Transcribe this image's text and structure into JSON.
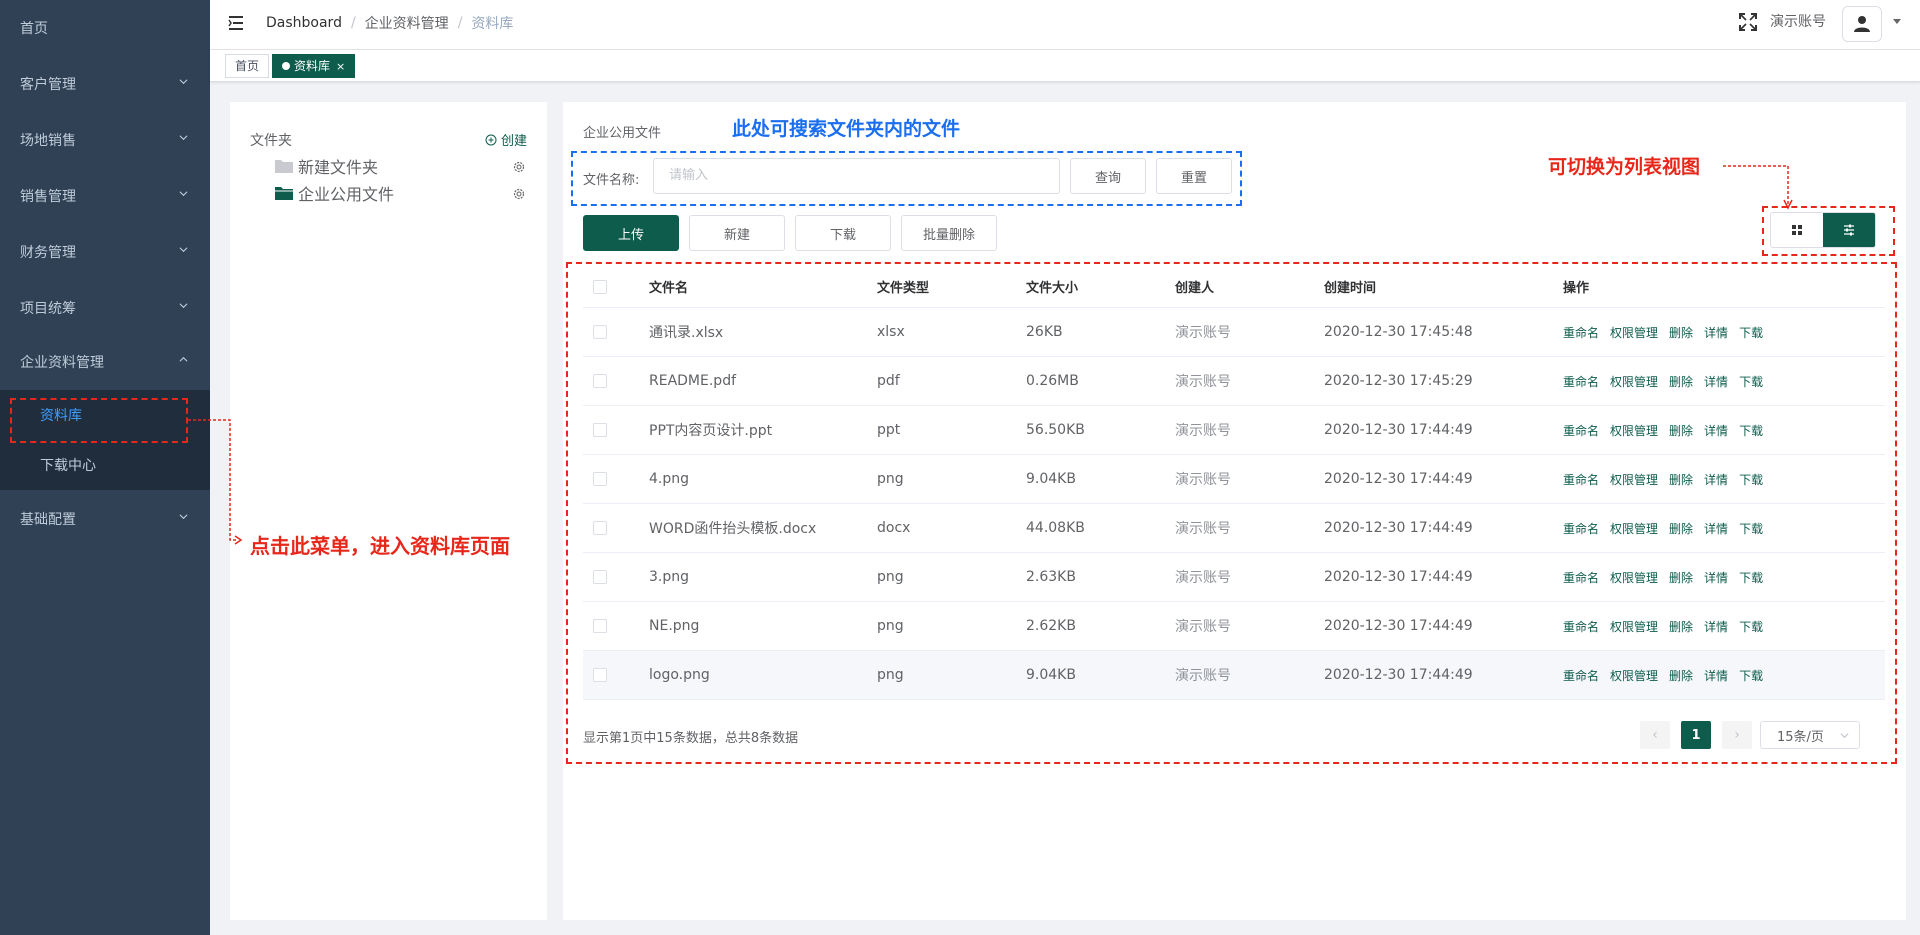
{
  "sidebar": {
    "items": [
      {
        "label": "首页"
      },
      {
        "label": "客户管理"
      },
      {
        "label": "场地销售"
      },
      {
        "label": "销售管理"
      },
      {
        "label": "财务管理"
      },
      {
        "label": "项目统筹"
      },
      {
        "label": "企业资料管理"
      },
      {
        "label": "基础配置"
      }
    ],
    "sub_items": [
      {
        "label": "资料库"
      },
      {
        "label": "下载中心"
      }
    ]
  },
  "navbar": {
    "breadcrumb": [
      "Dashboard",
      "企业资料管理",
      "资料库"
    ],
    "account_name": "演示账号"
  },
  "tags": [
    {
      "label": "首页"
    },
    {
      "label": "资料库",
      "close": "×"
    }
  ],
  "folders": {
    "title": "文件夹",
    "create_label": "创建",
    "items": [
      {
        "name": "新建文件夹"
      },
      {
        "name": "企业公用文件"
      }
    ]
  },
  "files": {
    "current_folder": "企业公用文件",
    "search": {
      "label": "文件名称:",
      "placeholder": "请输入",
      "query_label": "查询",
      "reset_label": "重置"
    },
    "actions": {
      "upload": "上传",
      "new": "新建",
      "download": "下载",
      "batch_delete": "批量删除"
    },
    "columns": [
      "文件名",
      "文件类型",
      "文件大小",
      "创建人",
      "创建时间",
      "操作"
    ],
    "op_labels": [
      "重命名",
      "权限管理",
      "删除",
      "详情",
      "下载"
    ],
    "rows": [
      {
        "name": "通讯录.xlsx",
        "type": "xlsx",
        "size": "26KB",
        "creator": "演示账号",
        "time": "2020-12-30 17:45:48"
      },
      {
        "name": "README.pdf",
        "type": "pdf",
        "size": "0.26MB",
        "creator": "演示账号",
        "time": "2020-12-30 17:45:29"
      },
      {
        "name": "PPT内容页设计.ppt",
        "type": "ppt",
        "size": "56.50KB",
        "creator": "演示账号",
        "time": "2020-12-30 17:44:49"
      },
      {
        "name": "4.png",
        "type": "png",
        "size": "9.04KB",
        "creator": "演示账号",
        "time": "2020-12-30 17:44:49"
      },
      {
        "name": "WORD函件抬头模板.docx",
        "type": "docx",
        "size": "44.08KB",
        "creator": "演示账号",
        "time": "2020-12-30 17:44:49"
      },
      {
        "name": "3.png",
        "type": "png",
        "size": "2.63KB",
        "creator": "演示账号",
        "time": "2020-12-30 17:44:49"
      },
      {
        "name": "NE.png",
        "type": "png",
        "size": "2.62KB",
        "creator": "演示账号",
        "time": "2020-12-30 17:44:49"
      },
      {
        "name": "logo.png",
        "type": "png",
        "size": "9.04KB",
        "creator": "演示账号",
        "time": "2020-12-30 17:44:49"
      }
    ],
    "pagination": {
      "info": "显示第1页中15条数据，总共8条数据",
      "current_page": "1",
      "page_size": "15条/页",
      "prev": "‹",
      "next": "›"
    }
  },
  "annotations": {
    "search_hint": "此处可搜索文件夹内的文件",
    "view_hint": "可切换为列表视图",
    "menu_hint": "点击此菜单，进入资料库页面"
  },
  "colors": {
    "brand": "#0d5c4c",
    "sidebar": "#304156",
    "annotation_red": "#e8271b",
    "annotation_blue": "#1a6ef0"
  }
}
